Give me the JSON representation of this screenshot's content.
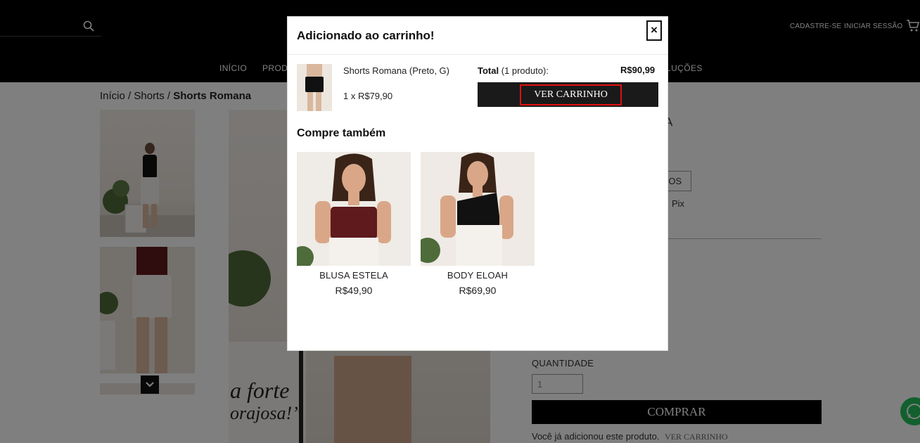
{
  "header": {
    "signup": "CADASTRE-SE",
    "login": "INICIAR SESSÃO",
    "nav": [
      "INÍCIO",
      "PROD",
      "LUÇÕES"
    ]
  },
  "breadcrumb": {
    "home": "Início",
    "sep1": " / ",
    "category": "Shorts",
    "sep2": " / ",
    "current": "Shorts Romana"
  },
  "product_page": {
    "title_fragment": "A",
    "size_fragment": "ROS",
    "pix_fragment": "Pix",
    "quantity_label": "QUANTIDADE",
    "quantity_value": "1",
    "buy_label": "COMPRAR",
    "added_note": "Você já adicionou este produto.",
    "added_link": "VER CARRINHO"
  },
  "modal": {
    "title": "Adicionado ao carrinho!",
    "close": "×",
    "item": {
      "name": "Shorts Romana (Preto, G)",
      "qty_price": "1 x R$79,90"
    },
    "total_label": "Total",
    "total_count": " (1 produto):",
    "total_value": "R$90,99",
    "cart_button": "VER CARRINHO",
    "also_title": "Compre também",
    "recommendations": [
      {
        "name": "BLUSA ESTELA",
        "price": "R$49,90"
      },
      {
        "name": "BODY ELOAH",
        "price": "R$69,90"
      }
    ]
  },
  "colors": {
    "accent_highlight": "#e01010",
    "button_dark": "#1a1a1a",
    "whatsapp": "#25c05a"
  }
}
